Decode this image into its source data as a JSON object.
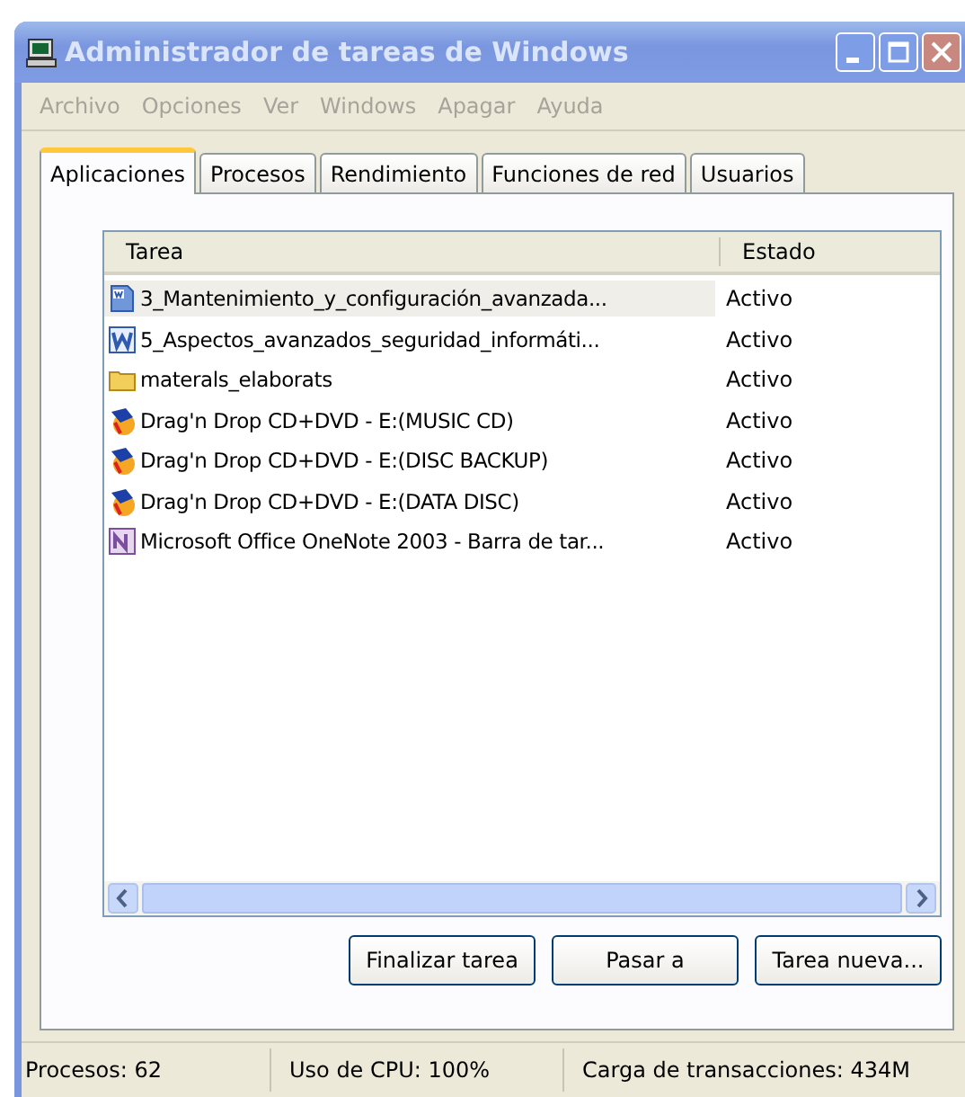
{
  "window": {
    "title": "Administrador de tareas de Windows"
  },
  "menu": [
    "Archivo",
    "Opciones",
    "Ver",
    "Windows",
    "Apagar",
    "Ayuda"
  ],
  "tabs": [
    {
      "label": "Aplicaciones",
      "selected": true
    },
    {
      "label": "Procesos",
      "selected": false
    },
    {
      "label": "Rendimiento",
      "selected": false
    },
    {
      "label": "Funciones de red",
      "selected": false
    },
    {
      "label": "Usuarios",
      "selected": false
    }
  ],
  "table": {
    "columns": [
      "Tarea",
      "Estado"
    ],
    "rows": [
      {
        "kind": "word-doc",
        "task": "3_Mantenimiento_y_configuración_avanzada...",
        "status": "Activo",
        "selected": true
      },
      {
        "kind": "word",
        "task": "5_Aspectos_avanzados_seguridad_informáti...",
        "status": "Activo",
        "selected": false
      },
      {
        "kind": "folder",
        "task": "materals_elaborats",
        "status": "Activo",
        "selected": false
      },
      {
        "kind": "burner",
        "task": "Drag'n Drop CD+DVD - E:(MUSIC CD)",
        "status": "Activo",
        "selected": false
      },
      {
        "kind": "burner",
        "task": "Drag'n Drop CD+DVD - E:(DISC BACKUP)",
        "status": "Activo",
        "selected": false
      },
      {
        "kind": "burner",
        "task": "Drag'n Drop CD+DVD - E:(DATA DISC)",
        "status": "Activo",
        "selected": false
      },
      {
        "kind": "onenote",
        "task": "Microsoft Office OneNote 2003 - Barra de tar...",
        "status": "Activo",
        "selected": false
      }
    ]
  },
  "buttons": [
    "Finalizar tarea",
    "Pasar a",
    "Tarea nueva..."
  ],
  "status_bar": [
    "Procesos: 62",
    "Uso de CPU: 100%",
    "Carga de transacciones: 434M"
  ]
}
